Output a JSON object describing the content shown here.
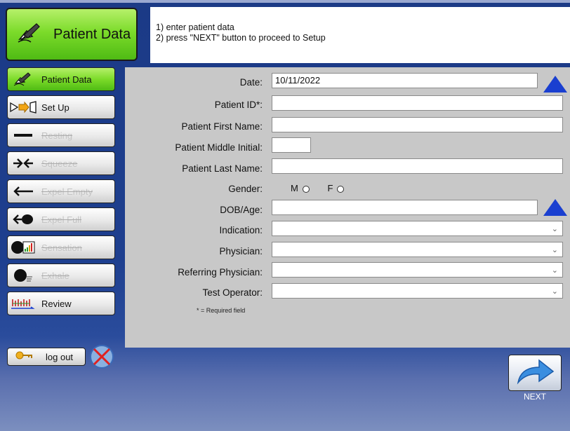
{
  "header": {
    "title": "Patient Data",
    "instructions": [
      "1) enter patient data",
      "2) press \"NEXT\" button to proceed to Setup"
    ]
  },
  "sidebar": {
    "items": [
      {
        "label": "Patient Data",
        "state": "active",
        "icon": "hand-writing-icon"
      },
      {
        "label": "Set Up",
        "state": "enabled",
        "icon": "setup-arrow-icon"
      },
      {
        "label": "Resting",
        "state": "disabled",
        "icon": "resting-bar-icon"
      },
      {
        "label": "Squeeze",
        "state": "disabled",
        "icon": "squeeze-arrows-icon"
      },
      {
        "label": "Expel Empty",
        "state": "disabled",
        "icon": "expel-empty-icon"
      },
      {
        "label": "Expel Full",
        "state": "disabled",
        "icon": "expel-full-icon"
      },
      {
        "label": "Sensation",
        "state": "disabled",
        "icon": "sensation-icon"
      },
      {
        "label": "Exhale",
        "state": "disabled",
        "icon": "exhale-icon"
      },
      {
        "label": "Review",
        "state": "enabled",
        "icon": "review-chart-icon"
      }
    ],
    "logout_label": "log out"
  },
  "form": {
    "date_label": "Date:",
    "date_value": "10/11/2022",
    "patient_id_label": "Patient ID*:",
    "first_name_label": "Patient First Name:",
    "middle_initial_label": "Patient Middle Initial:",
    "last_name_label": "Patient Last Name:",
    "gender_label": "Gender:",
    "gender_options": [
      "M",
      "F"
    ],
    "dob_label": "DOB/Age:",
    "indication_label": "Indication:",
    "physician_label": "Physician:",
    "referring_label": "Referring Physician:",
    "operator_label": "Test Operator:",
    "required_note": "* = Required field"
  },
  "next_label": "NEXT",
  "colors": {
    "active_green": "#7cdb2a",
    "panel_gray": "#c8c8c8",
    "background_blue": "#1e3f8f",
    "triangle_blue": "#1a3fd0"
  }
}
